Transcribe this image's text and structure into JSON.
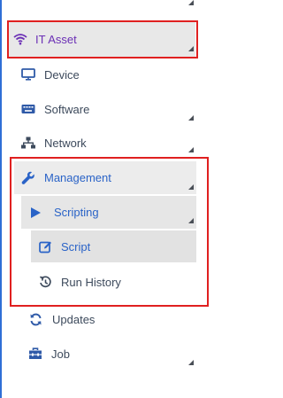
{
  "menu": {
    "it_asset": "IT Asset",
    "device": "Device",
    "software": "Software",
    "network": "Network",
    "management": "Management",
    "scripting": "Scripting",
    "script": "Script",
    "run_history": "Run History",
    "updates": "Updates",
    "job": "Job"
  },
  "colors": {
    "accent_blue": "#2a63c7",
    "accent_purple": "#6b2fb5",
    "highlight_red": "#e02020",
    "selected_bg": "#e6e6e6"
  },
  "icons": {
    "it_asset": "wifi-icon",
    "device": "monitor-icon",
    "software": "keyboard-icon",
    "network": "sitemap-icon",
    "management": "wrench-icon",
    "scripting": "play-icon",
    "script": "edit-icon",
    "run_history": "history-icon",
    "updates": "sync-icon",
    "job": "toolbox-icon"
  }
}
